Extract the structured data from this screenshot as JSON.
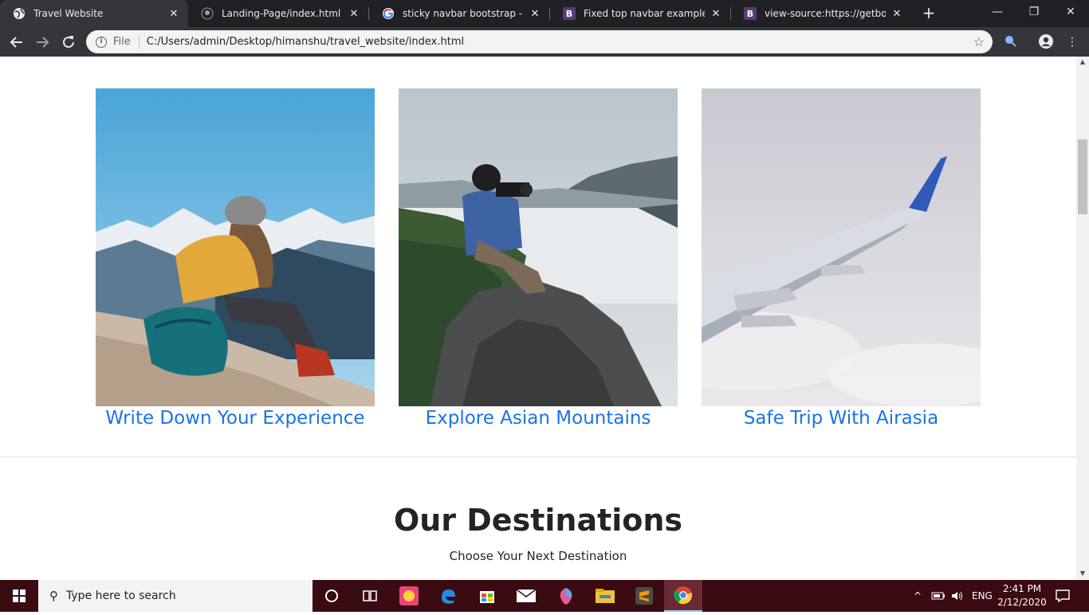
{
  "browser": {
    "tabs": [
      {
        "title": "Travel Website",
        "icon": "globe-icon",
        "active": true
      },
      {
        "title": "Landing-Page/index.html at m",
        "icon": "github-icon"
      },
      {
        "title": "sticky navbar bootstrap - Goog",
        "icon": "google-icon"
      },
      {
        "title": "Fixed top navbar example for B",
        "icon": "bootstrap-icon",
        "favicon_letter": "B"
      },
      {
        "title": "view-source:https://getbootstr",
        "icon": "bootstrap-icon",
        "favicon_letter": "B"
      }
    ],
    "new_tab": "+",
    "window_controls": {
      "minimize": "—",
      "restore": "❐",
      "close": "✕"
    },
    "address_bar": {
      "scheme_label": "File",
      "url": "C:/Users/admin/Desktop/himanshu/travel_website/index.html"
    }
  },
  "page": {
    "cards": [
      {
        "caption": "Write Down Your Experience",
        "image": "hiker-writing-on-mountain"
      },
      {
        "caption": "Explore Asian Mountains",
        "image": "photographer-on-rock-above-clouds"
      },
      {
        "caption": "Safe Trip With Airasia",
        "image": "airplane-wing-in-clouds"
      }
    ],
    "section": {
      "title": "Our Destinations",
      "subtitle": "Choose Your Next Destination"
    },
    "colors": {
      "link": "#1a73e8",
      "heading": "#212529"
    }
  },
  "taskbar": {
    "search_placeholder": "Type here to search",
    "language": "ENG",
    "time": "2:41 PM",
    "date": "2/12/2020",
    "apps": [
      "cortana-icon",
      "task-view-icon",
      "candy-crush-icon",
      "edge-icon",
      "store-icon",
      "mail-icon",
      "paint3d-icon",
      "file-explorer-icon",
      "sublime-text-icon",
      "chrome-icon"
    ]
  }
}
